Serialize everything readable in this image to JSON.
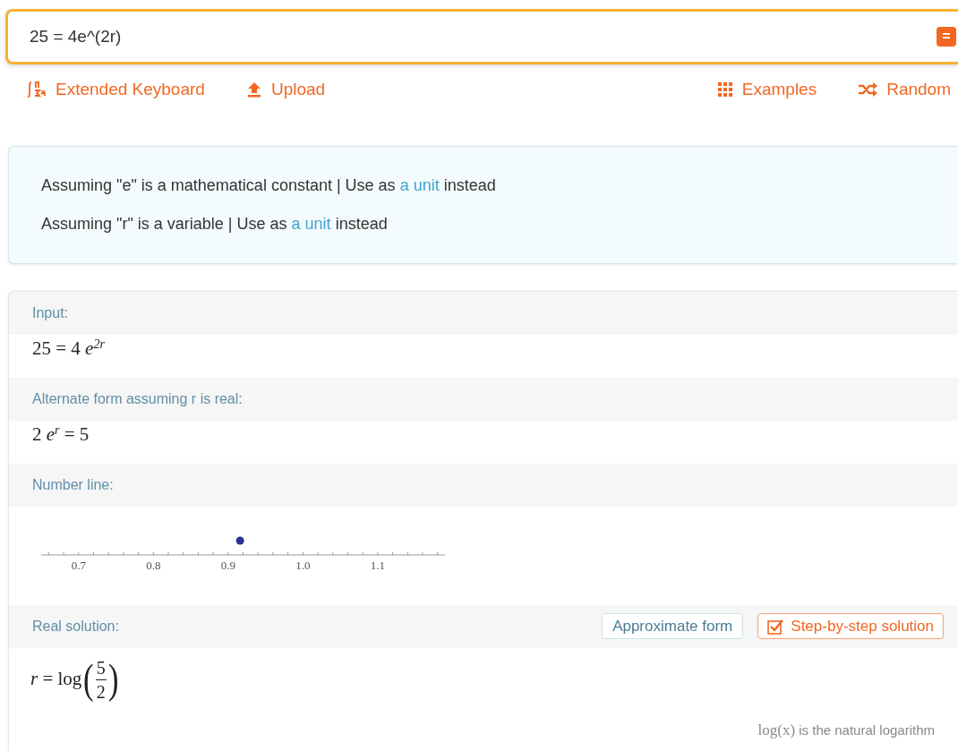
{
  "search": {
    "value": "25 = 4e^(2r)",
    "submit": "="
  },
  "toolbar": {
    "left": [
      {
        "kind": "keyboard",
        "label": "Extended Keyboard"
      },
      {
        "kind": "upload",
        "label": "Upload"
      }
    ],
    "right": [
      {
        "kind": "examples",
        "label": "Examples"
      },
      {
        "kind": "random",
        "label": "Random"
      }
    ]
  },
  "assumptions": [
    {
      "text": "Assuming \"e\" is a mathematical constant | Use as",
      "link": "a unit",
      "after": "instead"
    },
    {
      "text": "Assuming \"r\" is a variable | Use as",
      "link": "a unit",
      "after": "instead"
    }
  ],
  "pods": [
    {
      "title": "Input:",
      "kind": "power",
      "lhs": "25 = 4",
      "base": "e",
      "exponent": "2r"
    },
    {
      "title": "Alternate form assuming r is real:",
      "kind": "power",
      "lhs": "2",
      "base": "e",
      "exponent": "r",
      "rhs": "= 5"
    },
    {
      "title": "Number line:",
      "kind": "numberline",
      "ticks": [
        "0.7",
        "0.8",
        "0.9",
        "1.0",
        "1.1"
      ]
    },
    {
      "title": "Real solution:",
      "kind": "log",
      "buttons": [
        {
          "kind": "plain",
          "label": "Approximate form"
        },
        {
          "kind": "steps",
          "label": "Step-by-step solution"
        }
      ],
      "lhs": "r = log",
      "open": "(",
      "numerator": "5",
      "denominator": "2",
      "close": ")",
      "footnote_math": "log(x)",
      "footnote": "is the natural logarithm"
    }
  ]
}
